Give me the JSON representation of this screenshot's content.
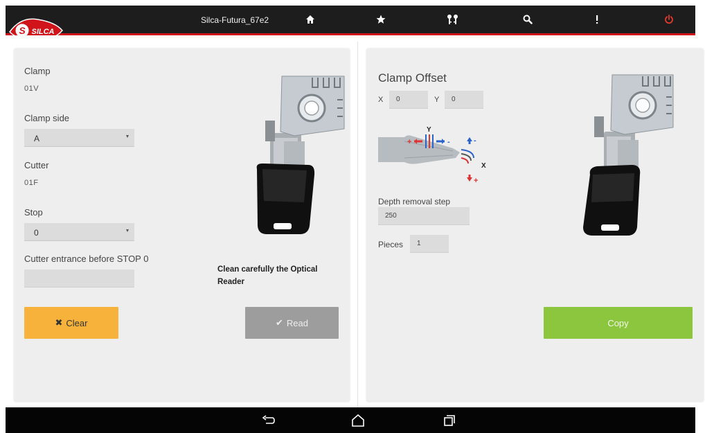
{
  "app": {
    "title": "Silca-Futura_67e2",
    "logo_text": "SILCA"
  },
  "toolbar": {
    "icons": [
      "home-icon",
      "star-icon",
      "keys-icon",
      "search-icon",
      "more-vert-icon",
      "power-icon"
    ],
    "power_color": "#e23a2e"
  },
  "left_panel": {
    "clamp_label": "Clamp",
    "clamp_value": "01V",
    "clamp_side_label": "Clamp side",
    "clamp_side_value": "A",
    "cutter_label": "Cutter",
    "cutter_value": "01F",
    "stop_label": "Stop",
    "stop_value": "0",
    "cutter_entrance_label": "Cutter entrance before STOP 0",
    "cutter_entrance_value": "",
    "note": "Clean carefully the Optical Reader",
    "clear_label": "Clear",
    "read_label": "Read"
  },
  "right_panel": {
    "title": "Clamp Offset",
    "x_label": "X",
    "x_value": "0",
    "y_label": "Y",
    "y_value": "0",
    "diagram": {
      "y_axis": "Y",
      "x_axis": "X",
      "plus": "+",
      "minus": "-"
    },
    "depth_label": "Depth removal step",
    "depth_value": "250",
    "pieces_label": "Pieces",
    "pieces_value": "1",
    "copy_label": "Copy"
  },
  "colors": {
    "accent_red": "#d0141a",
    "clear_button": "#f7b23b",
    "read_button": "#9d9d9d",
    "copy_button": "#8cc63e"
  }
}
